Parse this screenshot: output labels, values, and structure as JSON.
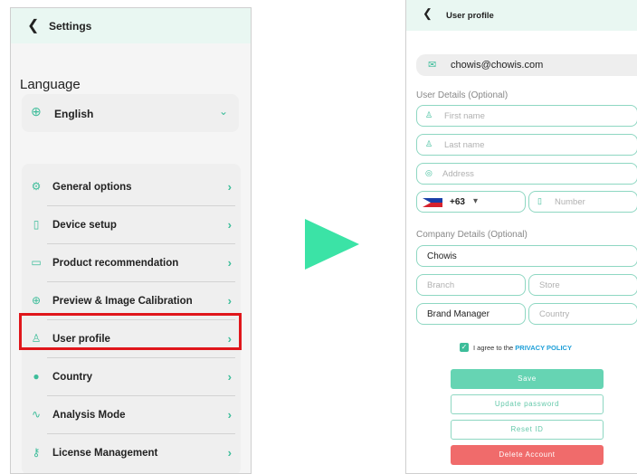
{
  "left": {
    "header": {
      "back_icon": "chevron-left-icon",
      "title": "Settings"
    },
    "language": {
      "label": "Language",
      "value": "English",
      "icon": "globe-icon",
      "dropdown_icon": "chevron-down-icon"
    },
    "menu": [
      {
        "label": "General options",
        "icon": "gear-icon",
        "glyph": "⚙"
      },
      {
        "label": "Device setup",
        "icon": "phone-icon",
        "glyph": "▯"
      },
      {
        "label": "Product recommendation",
        "icon": "product-icon",
        "glyph": "▭"
      },
      {
        "label": "Preview & Image Calibration",
        "icon": "crosshair-icon",
        "glyph": "⊕"
      },
      {
        "label": "User profile",
        "icon": "user-icon",
        "glyph": "♙"
      },
      {
        "label": "Country",
        "icon": "earth-icon",
        "glyph": "●"
      },
      {
        "label": "Analysis Mode",
        "icon": "pulse-icon",
        "glyph": "∿"
      },
      {
        "label": "License Management",
        "icon": "key-icon",
        "glyph": "⚷"
      }
    ],
    "highlight_color": "#e0161b"
  },
  "arrow_color": "#3be3a6",
  "right": {
    "header": {
      "back_icon": "chevron-left-icon",
      "title": "User profile"
    },
    "email": "chowis@chowis.com",
    "user_section": "User Details (Optional)",
    "first_name_placeholder": "First name",
    "last_name_placeholder": "Last name",
    "address_placeholder": "Address",
    "phone_code": "+63",
    "number_placeholder": "Number",
    "company_section": "Company Details (Optional)",
    "company_value": "Chowis",
    "branch_placeholder": "Branch",
    "store_placeholder": "Store",
    "role_value": "Brand Manager",
    "country_placeholder": "Country",
    "agree_text": "I agree to the",
    "privacy_link": "PRIVACY POLICY",
    "buttons": {
      "save": "Save",
      "update_password": "Update password",
      "reset_id": "Reset ID",
      "delete_account": "Delete Account"
    },
    "accent": "#3dbd9a",
    "danger": "#f06b6b"
  }
}
